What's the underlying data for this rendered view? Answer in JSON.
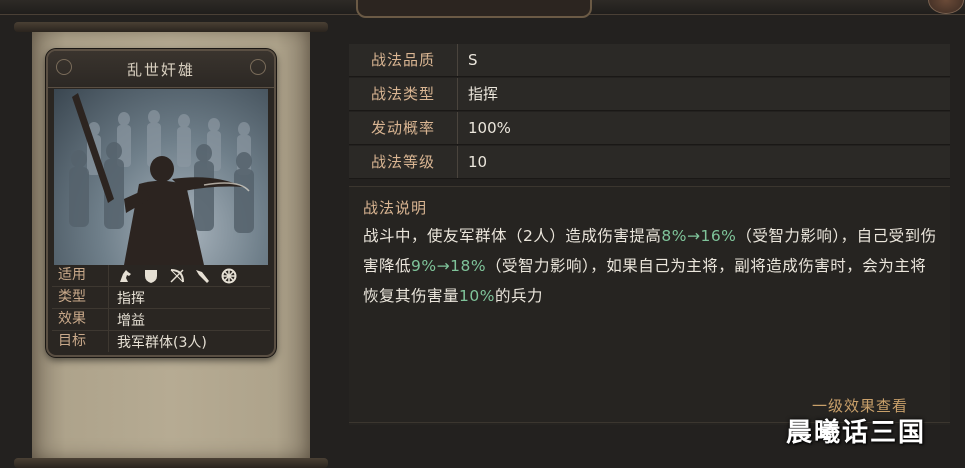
{
  "header": {},
  "card": {
    "title": "乱世奸雄",
    "rows": [
      {
        "label": "适用",
        "icons": [
          "cavalry-icon",
          "shield-icon",
          "bow-icon",
          "spear-icon",
          "siege-wheel-icon"
        ]
      },
      {
        "label": "类型",
        "value": "指挥"
      },
      {
        "label": "效果",
        "value": "增益"
      },
      {
        "label": "目标",
        "value": "我军群体(3人)"
      }
    ]
  },
  "attributes": [
    {
      "label": "战法品质",
      "value": "S"
    },
    {
      "label": "战法类型",
      "value": "指挥"
    },
    {
      "label": "发动概率",
      "value": "100%"
    },
    {
      "label": "战法等级",
      "value": "10"
    }
  ],
  "description": {
    "title": "战法说明",
    "segments": [
      {
        "text": "战斗中，使友军群体（2人）造成伤害提高",
        "hl": false
      },
      {
        "text": "8%→16%",
        "hl": true
      },
      {
        "text": "（受智力影响），自己受到伤害降低",
        "hl": false
      },
      {
        "text": "9%→18%",
        "hl": true
      },
      {
        "text": "（受智力影响），如果自己为主将，副将造成伤害时，会为主将恢复其伤害量",
        "hl": false
      },
      {
        "text": "10%",
        "hl": true
      },
      {
        "text": "的兵力",
        "hl": false
      }
    ]
  },
  "level_link": "一级效果查看",
  "watermark": "晨曦话三国",
  "colors": {
    "label": "#d9b592",
    "highlight": "#7fc49a",
    "link": "#c9a06a"
  }
}
